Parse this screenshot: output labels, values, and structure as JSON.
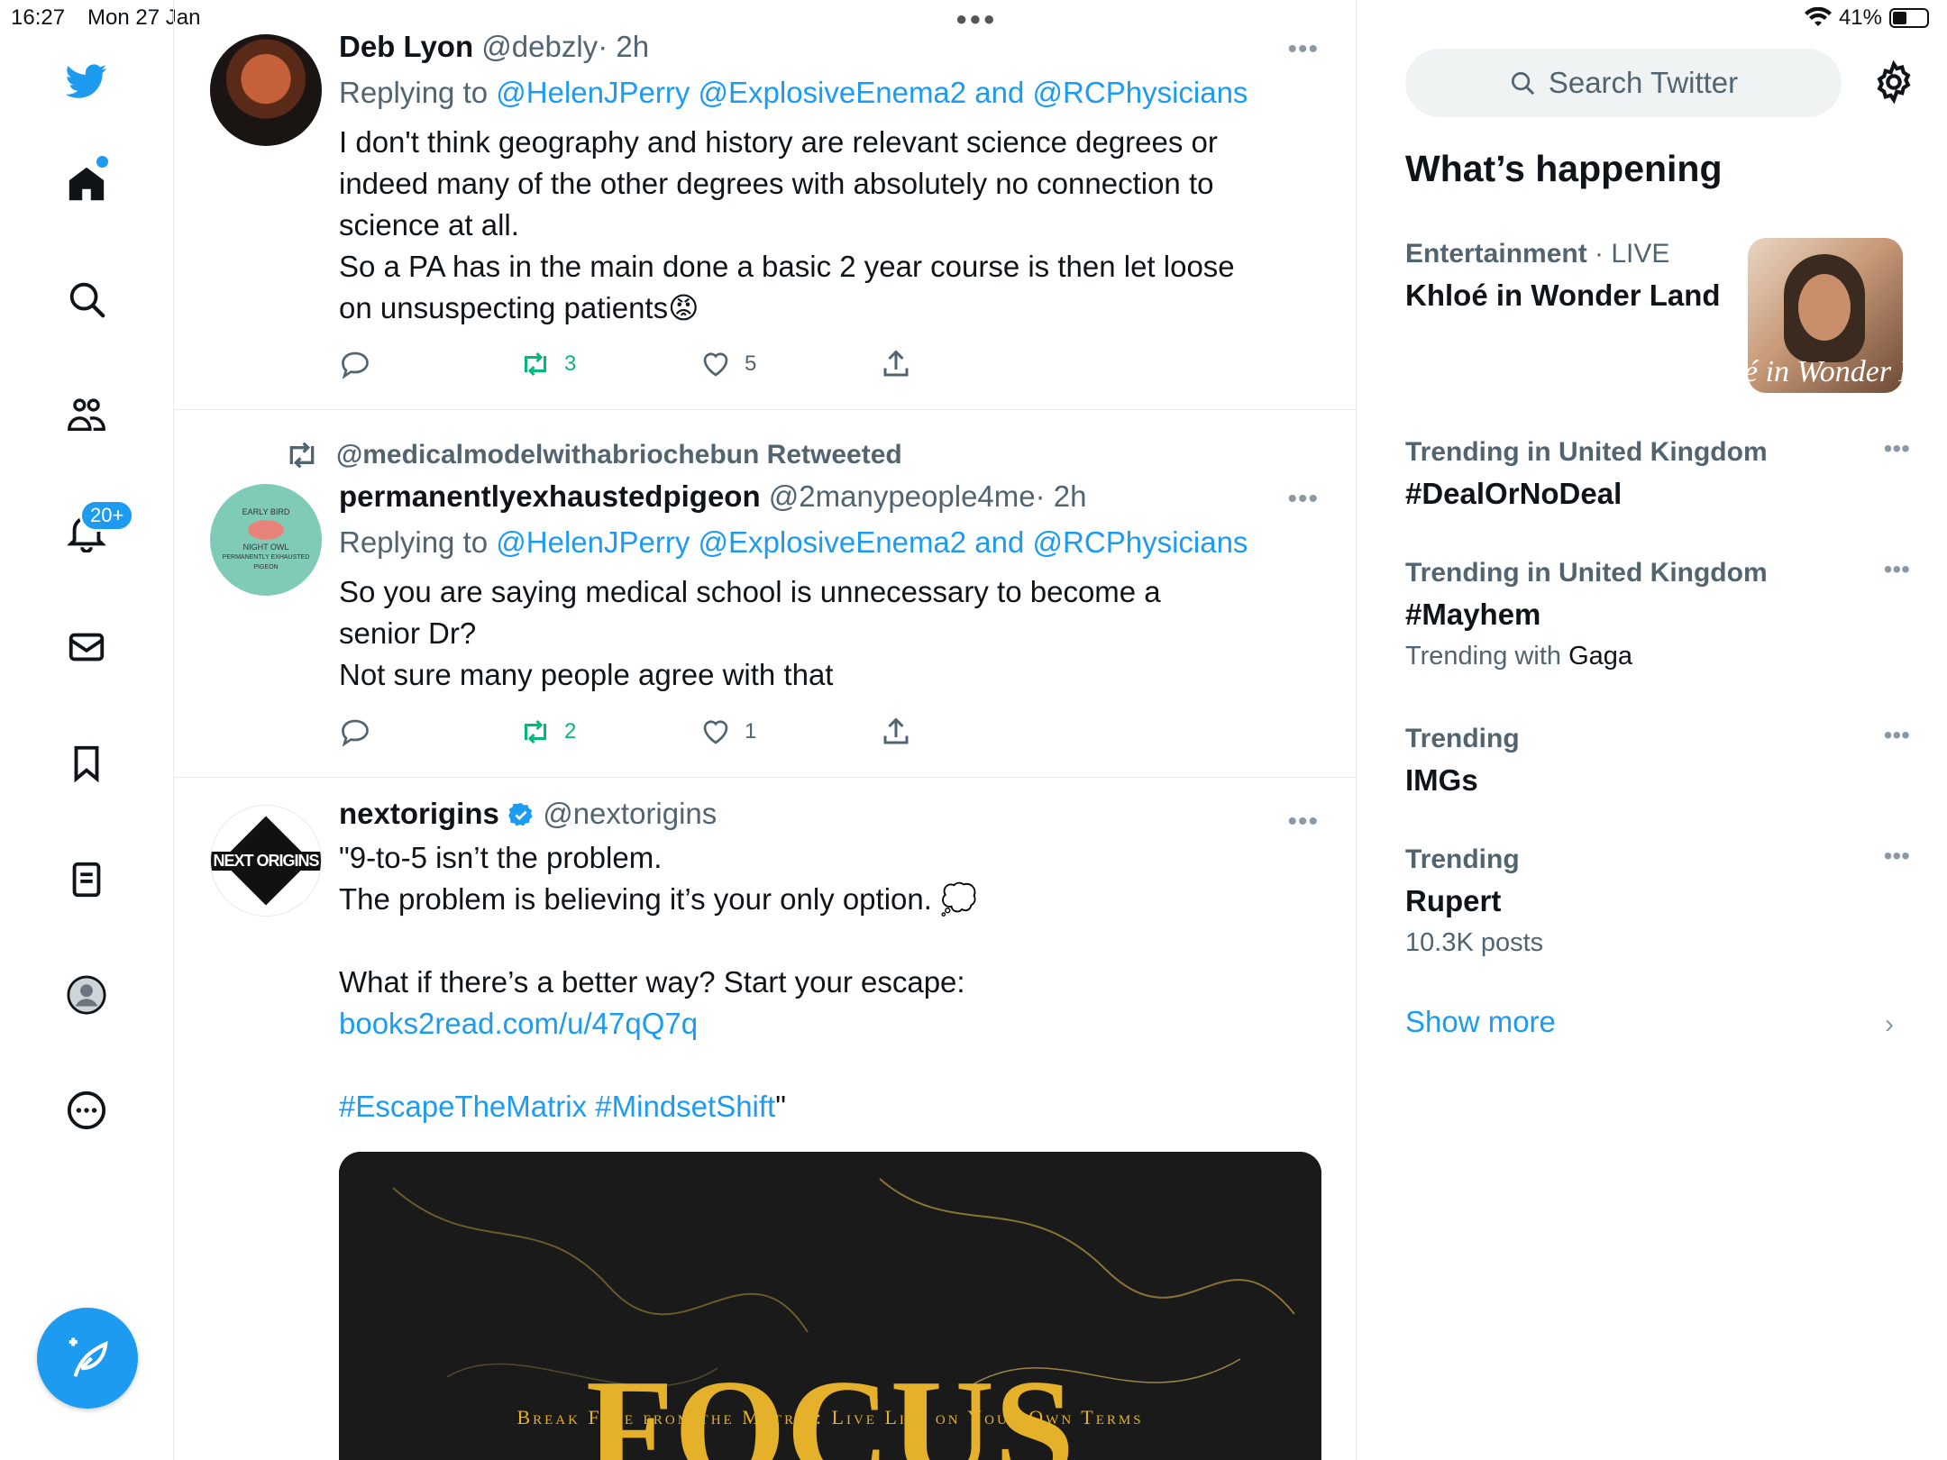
{
  "status_bar": {
    "time": "16:27",
    "date": "Mon 27 Jan",
    "battery": "41%"
  },
  "nav": {
    "notifications_badge": "20+"
  },
  "tweets": [
    {
      "name": "Deb Lyon",
      "handle": "@debzly",
      "time": "· 2h",
      "replying_prefix": "Replying to ",
      "replying_to": "@HelenJPerry @ExplosiveEnema2 and @RCPhysicians",
      "text": "I don't think geography and history are relevant science degrees or indeed many of the other degrees with absolutely no connection to science at all.\nSo a PA has in the main done a basic 2 year course is then let loose on unsuspecting patients😡",
      "retweets": "3",
      "likes": "5"
    },
    {
      "retweeted_by": "@medicalmodelwithabriochebun Retweeted",
      "name": "permanentlyexhaustedpigeon",
      "handle": "@2manypeople4me",
      "time": "· 2h",
      "replying_prefix": "Replying to ",
      "replying_to": "@HelenJPerry @ExplosiveEnema2 and @RCPhysicians",
      "text": "So you are saying medical school is unnecessary to become a senior Dr?\nNot sure many people agree with that",
      "retweets": "2",
      "likes": "1",
      "avatar_lines": [
        "EARLY BIRD",
        "NIGHT OWL",
        "PERMANENTLY EXHAUSTED PIGEON"
      ]
    },
    {
      "name": "nextorigins",
      "handle": "@nextorigins",
      "text_line1": "\"9-to-5 isn’t the problem.",
      "text_line2": "The problem is believing it’s your only option. 💭",
      "text_line3": "What if there’s a better way? Start your escape: ",
      "link": "books2read.com/u/47qQ7q",
      "hashtags": "#EscapeTheMatrix #MindsetShift",
      "hashtags_suffix": "\"",
      "avatar_text": "NEXT ORIGINS",
      "media_title": "FOCUS",
      "media_subtitle": "Break Free from the Matrix: Live Life on Your Own Terms"
    }
  ],
  "sidebar": {
    "search_placeholder": "Search Twitter",
    "title": "What’s happening",
    "trends": [
      {
        "meta": "Entertainment",
        "meta_suffix": " · LIVE",
        "name": "Khloé in Wonder Land",
        "image_text": "é in Wonder L"
      },
      {
        "meta": "Trending in United Kingdom",
        "name": "#DealOrNoDeal"
      },
      {
        "meta": "Trending in United Kingdom",
        "name": "#Mayhem",
        "sub_prefix": "Trending with ",
        "sub_value": "Gaga"
      },
      {
        "meta": "Trending",
        "name": "IMGs"
      },
      {
        "meta": "Trending",
        "name": "Rupert",
        "sub": "10.3K posts"
      }
    ],
    "show_more": "Show more"
  },
  "colors": {
    "accent": "#1d9bf0",
    "retweet": "#00ba7c",
    "muted": "#536471"
  },
  "icons": [
    "twitter-logo-icon",
    "home-icon",
    "search-icon",
    "communities-icon",
    "bell-icon",
    "mail-icon",
    "bookmark-icon",
    "lists-icon",
    "profile-icon",
    "more-icon",
    "compose-icon",
    "reply-icon",
    "retweet-icon",
    "like-icon",
    "share-icon",
    "verified-icon",
    "gear-icon",
    "chevron-right-icon",
    "wifi-icon",
    "battery-icon"
  ]
}
